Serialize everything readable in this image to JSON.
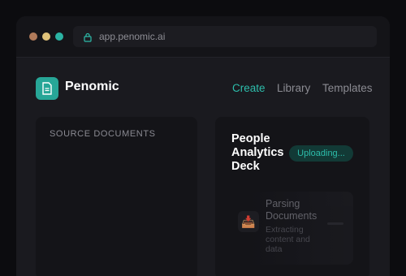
{
  "browser": {
    "url": "app.penomic.ai"
  },
  "app": {
    "name": "Penomic"
  },
  "nav": {
    "create": "Create",
    "library": "Library",
    "templates": "Templates",
    "active": "Create"
  },
  "source_panel": {
    "title": "SOURCE DOCUMENTS"
  },
  "deck_panel": {
    "title": "People Analytics Deck",
    "status": "Uploading...",
    "step": {
      "icon": "inbox-tray-icon",
      "title": "Parsing Documents",
      "description": "Extracting content and data"
    }
  },
  "colors": {
    "accent": "#2dbdab",
    "badge_bg": "#123a36",
    "window_bg": "#1a1a1f"
  }
}
